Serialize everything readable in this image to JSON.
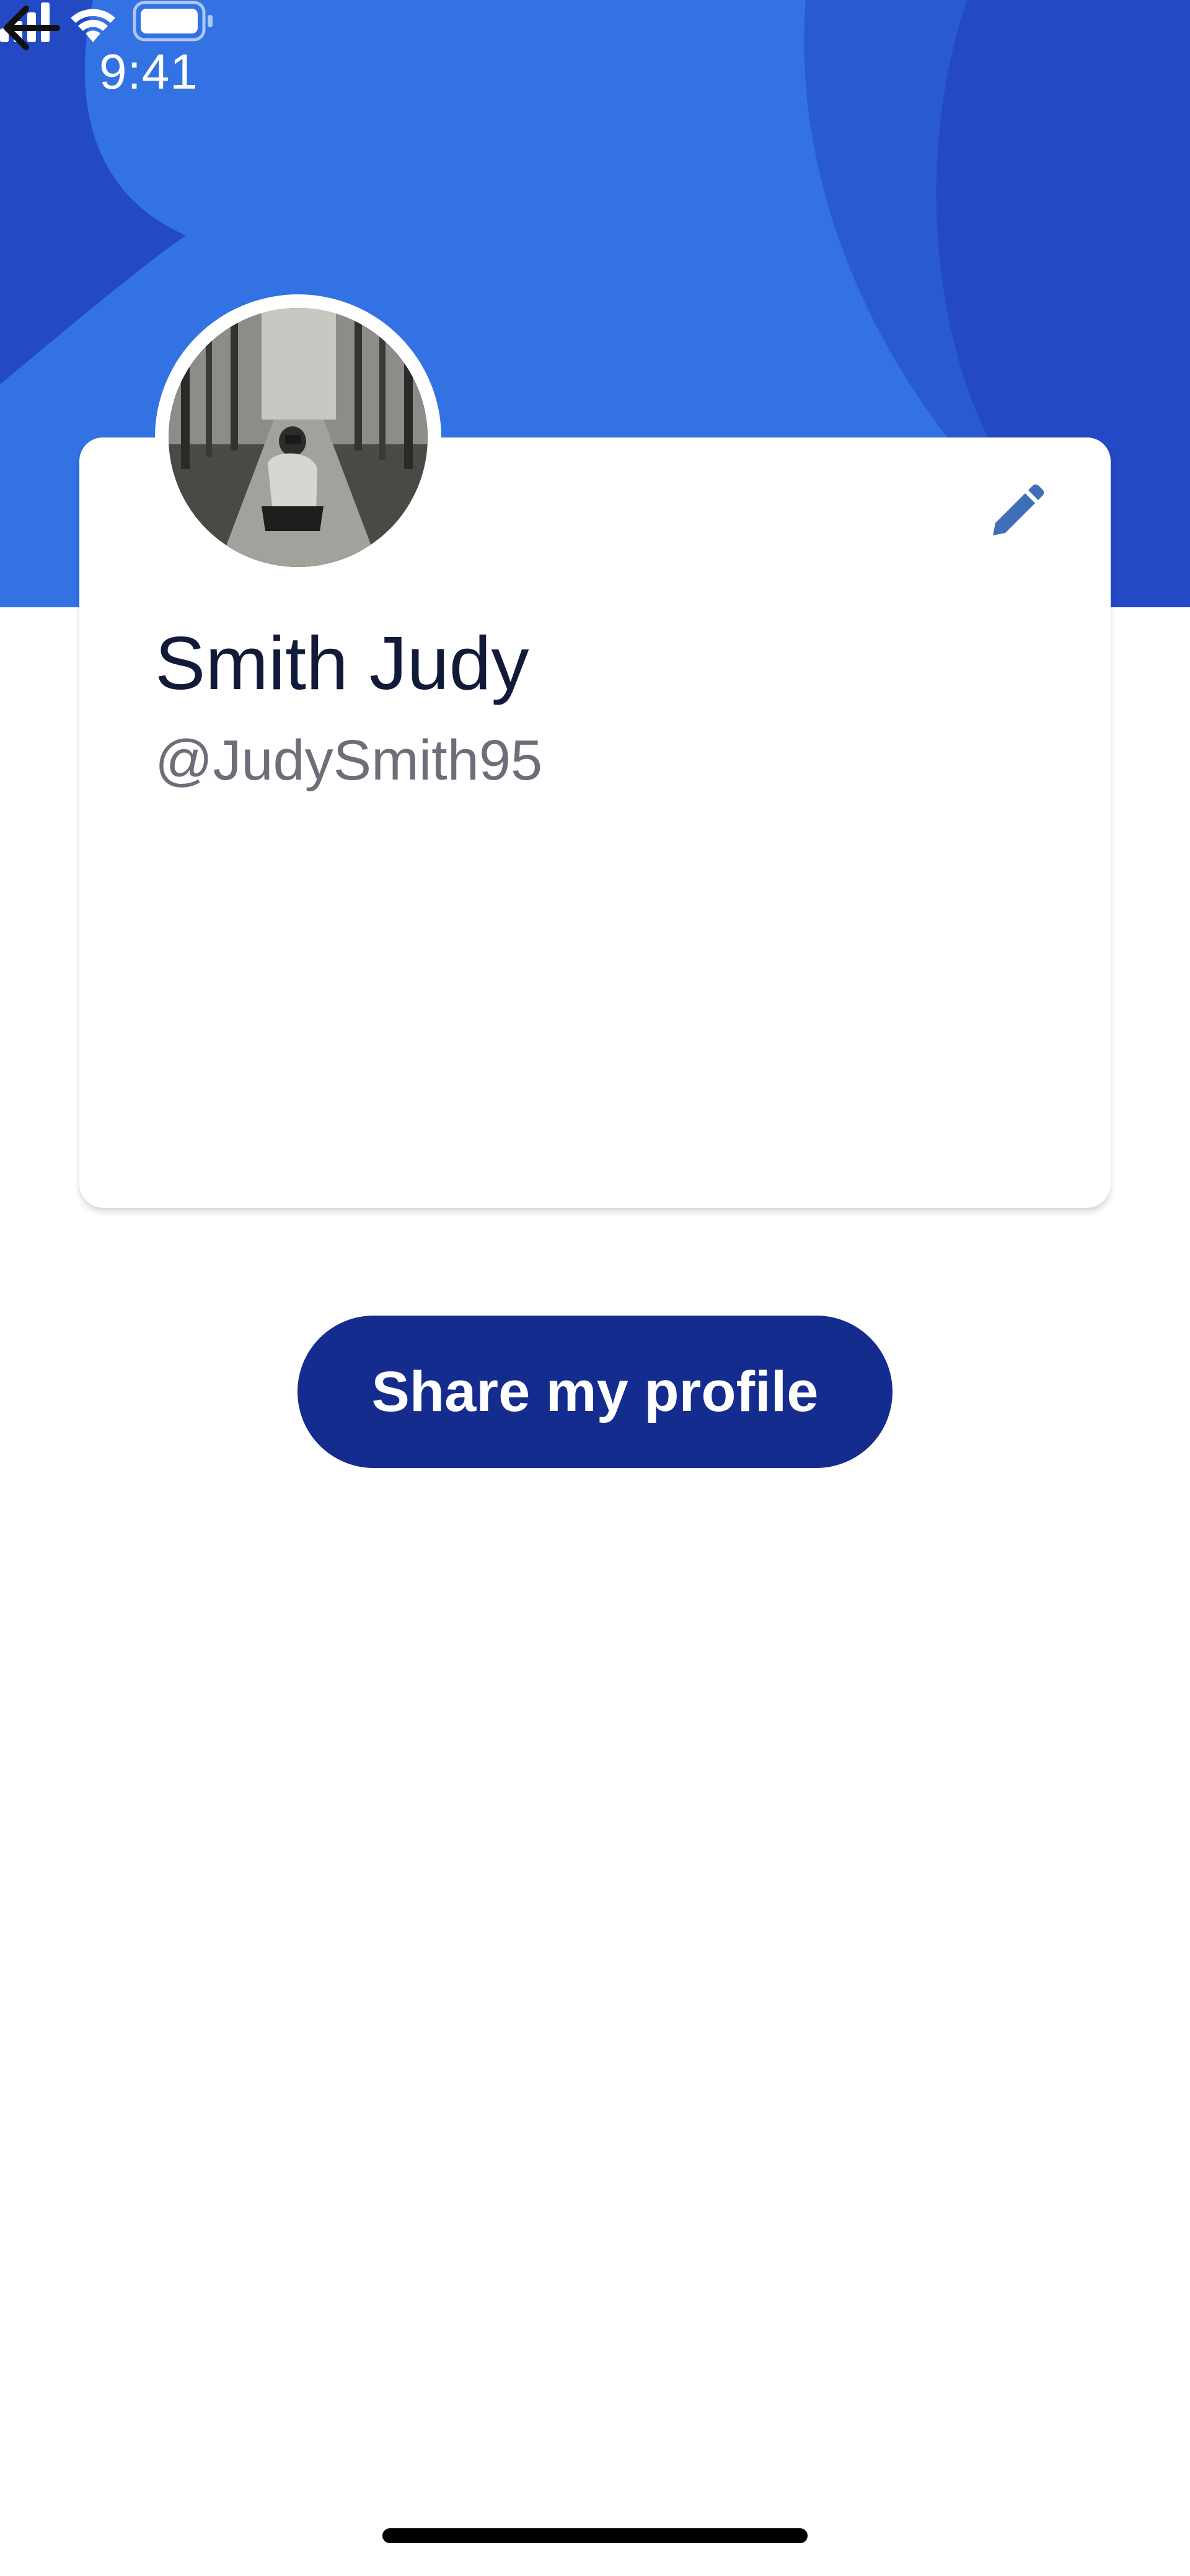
{
  "colors": {
    "header_bg": "#2349c4",
    "header_wave": "#3272e2",
    "accent_dark": "#142c8e",
    "name_text": "#121a3a",
    "handle_text": "#6c6f78",
    "edit_icon": "#3f6fb8"
  },
  "status_bar": {
    "time": "9:41",
    "icons": [
      "signal-icon",
      "wifi-icon",
      "battery-icon"
    ]
  },
  "header": {
    "back_icon": "arrow-left-icon"
  },
  "profile": {
    "name": "Smith Judy",
    "handle": "@JudySmith95",
    "avatar_desc": "person-photo",
    "edit_icon": "pencil-icon"
  },
  "actions": {
    "share_label": "Share my profile"
  }
}
